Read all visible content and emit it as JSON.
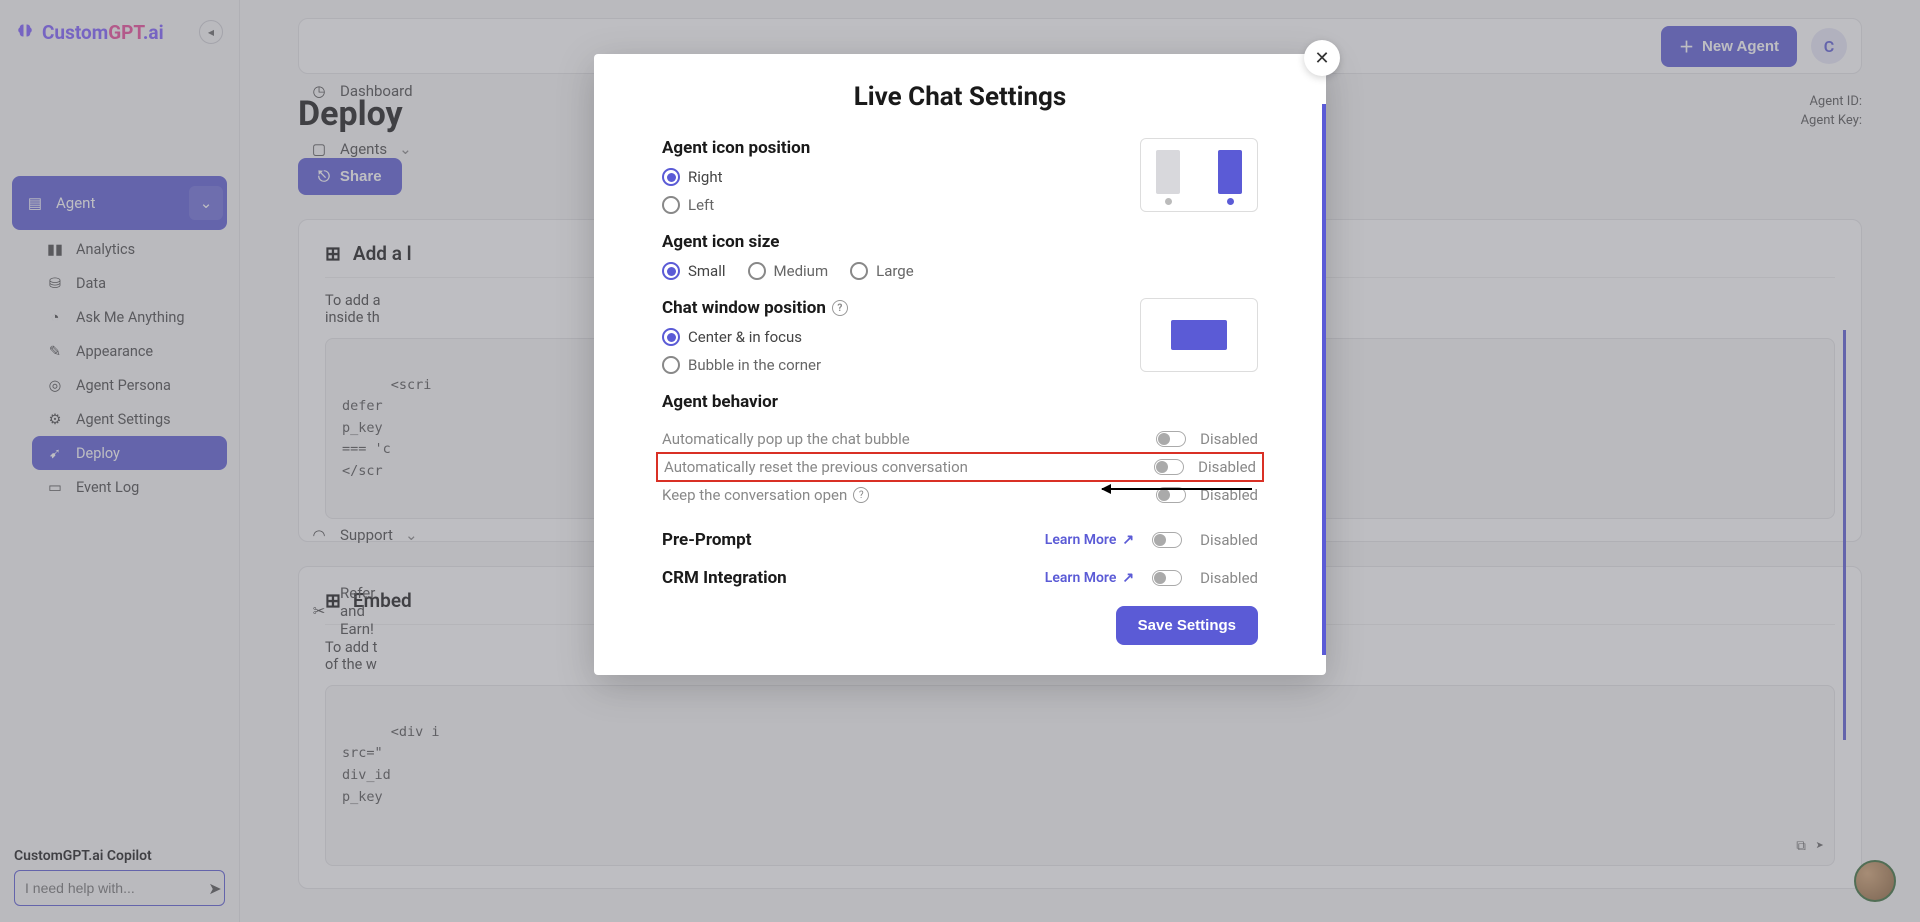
{
  "brand": {
    "name_1": "Custom",
    "name_2": "GPT",
    "name_3": ".ai"
  },
  "sidebar": {
    "dashboard": "Dashboard",
    "agents": "Agents",
    "agent": "Agent",
    "analytics": "Analytics",
    "data": "Data",
    "ask": "Ask Me Anything",
    "appearance": "Appearance",
    "persona": "Agent Persona",
    "settings": "Agent Settings",
    "deploy": "Deploy",
    "eventlog": "Event Log",
    "support": "Support",
    "refer": "Refer and Earn!"
  },
  "copilot": {
    "title": "CustomGPT.ai Copilot",
    "placeholder": "I need help with..."
  },
  "topbar": {
    "new_agent": "New Agent",
    "avatar_initial": "C"
  },
  "page": {
    "title": "Deploy",
    "agent_id_label": "Agent ID:",
    "agent_key_label": "Agent Key:",
    "share": "Share"
  },
  "sections": {
    "s1": {
      "title": "Add a l",
      "desc1": "To add a",
      "desc2": "inside th",
      "code": "<scri\ndefer\np_key\n=== 'c\n</scr"
    },
    "s2": {
      "title": "Embed",
      "desc1": "To add t",
      "desc2": "of the w",
      "code": "<div i\nsrc=\"\ndiv_id\np_key"
    }
  },
  "modal": {
    "title": "Live Chat Settings",
    "icon_position": {
      "label": "Agent icon position",
      "right": "Right",
      "left": "Left"
    },
    "icon_size": {
      "label": "Agent icon size",
      "small": "Small",
      "medium": "Medium",
      "large": "Large"
    },
    "window_position": {
      "label": "Chat window position",
      "center": "Center & in focus",
      "bubble": "Bubble in the corner"
    },
    "behavior": {
      "label": "Agent behavior",
      "popup": "Automatically pop up the chat bubble",
      "reset": "Automatically reset the previous conversation",
      "keep": "Keep the conversation open"
    },
    "preprompt": {
      "label": "Pre-Prompt",
      "learn": "Learn More"
    },
    "crm": {
      "label": "CRM Integration",
      "learn": "Learn More"
    },
    "disabled": "Disabled",
    "save": "Save Settings"
  }
}
